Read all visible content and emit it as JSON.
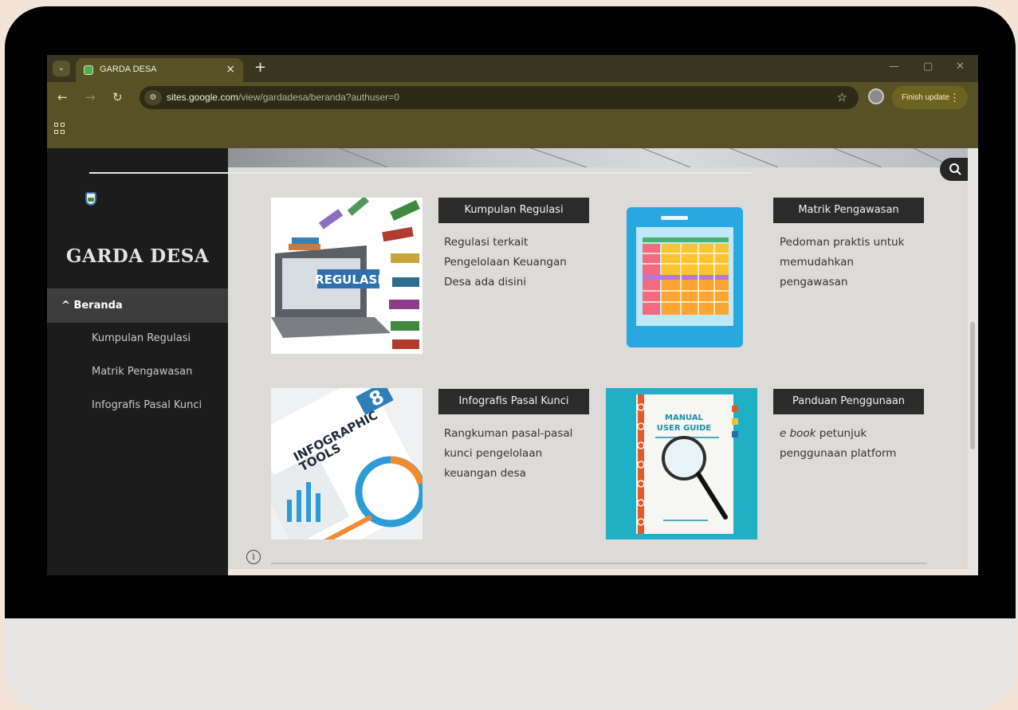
{
  "browser": {
    "tab_title": "GARDA DESA",
    "tab_close": "×",
    "new_tab": "+",
    "url_host": "sites.google.com",
    "url_path": "/view/gardadesa/beranda?authuser=0",
    "finish_update": "Finish update",
    "icons": [
      "tab-list-icon",
      "favicon-icon",
      "back-icon",
      "forward-icon",
      "reload-icon",
      "site-info-icon",
      "star-icon",
      "profile-icon",
      "more-menu-icon",
      "apps-icon",
      "minimize-icon",
      "maximize-icon",
      "window-close-icon"
    ]
  },
  "site": {
    "title": "GARDA DESA",
    "nav": {
      "home": "Beranda",
      "items": [
        "Kumpulan Regulasi",
        "Matrik Pengawasan",
        "Infografis Pasal Kunci"
      ]
    }
  },
  "cards": [
    {
      "label": "Kumpulan Regulasi",
      "description": "Regulasi terkait Pengelolaan Keuangan Desa ada disini",
      "image_text": "REGULASI"
    },
    {
      "label": "Matrik Pengawasan",
      "description": "Pedoman praktis untuk memudahkan pengawasan"
    },
    {
      "label": "Infografis Pasal Kunci",
      "description": "Rangkuman pasal-pasal kunci pengelolaan keuangan desa",
      "image_text_line1": "INFOGRAPHIC",
      "image_text_line2": "TOOLS",
      "image_number": "8"
    },
    {
      "label": "Panduan Penggunaan",
      "description_emphasis": "e book",
      "description_rest": " petunjuk penggunaan platform",
      "image_text_line1": "MANUAL",
      "image_text_line2": "USER GUIDE"
    }
  ],
  "colors": {
    "tab_strip": "#3a3520",
    "toolbar": "#585126",
    "sidebar": "#1c1c1c",
    "label_bg": "#2b2b2b",
    "page_bg": "#dddbd7"
  }
}
